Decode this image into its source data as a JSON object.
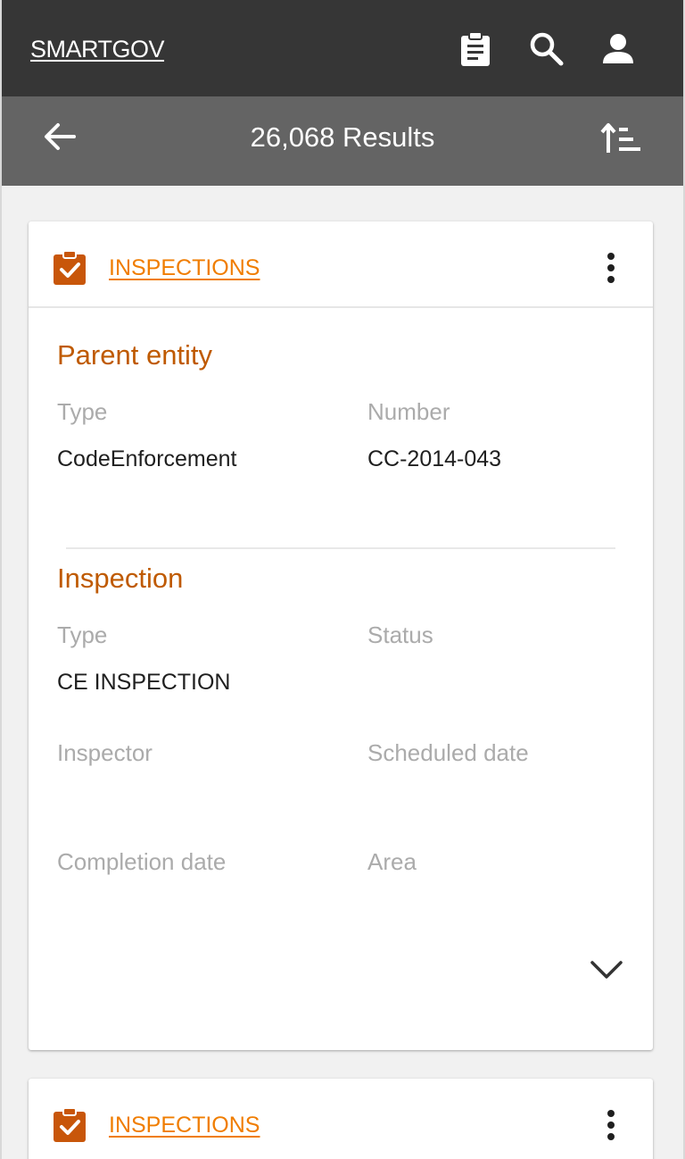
{
  "app": {
    "brand": "SMARTGOV"
  },
  "header": {
    "icons": [
      "clipboard-icon",
      "search-icon",
      "account-icon"
    ]
  },
  "results_bar": {
    "count_text": "26,068 Results",
    "back_icon": "arrow-left-icon",
    "sort_icon": "sort-icon"
  },
  "cards": [
    {
      "type_label": "INSPECTIONS",
      "type_icon": "clipboard-check-icon",
      "menu_icon": "more-vert-icon",
      "parent_section": {
        "title": "Parent entity",
        "fields": [
          {
            "label": "Type",
            "value": "CodeEnforcement"
          },
          {
            "label": "Number",
            "value": "CC-2014-043"
          }
        ]
      },
      "inspection_section": {
        "title": "Inspection",
        "fields": [
          {
            "label": "Type",
            "value": "CE INSPECTION"
          },
          {
            "label": "Status",
            "value": ""
          },
          {
            "label": "Inspector",
            "value": ""
          },
          {
            "label": "Scheduled date",
            "value": ""
          },
          {
            "label": "Completion date",
            "value": ""
          },
          {
            "label": "Area",
            "value": ""
          }
        ]
      },
      "expand_icon": "chevron-down-icon"
    },
    {
      "type_label": "INSPECTIONS",
      "type_icon": "clipboard-check-icon",
      "menu_icon": "more-vert-icon"
    }
  ],
  "colors": {
    "topbar": "#363636",
    "results_bar": "#646464",
    "accent_orange": "#f07d00",
    "section_title": "#bf5a00",
    "icon_orange": "#c8560a",
    "background": "#f1f1f1"
  }
}
